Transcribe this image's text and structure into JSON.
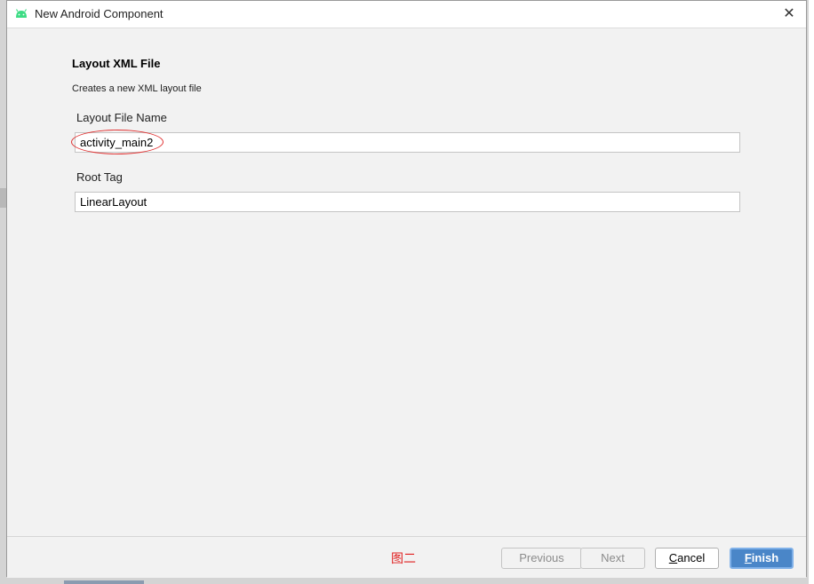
{
  "window": {
    "title": "New Android Component",
    "close_symbol": "✕",
    "icon": "android-icon"
  },
  "form": {
    "section_title": "Layout XML File",
    "section_description": "Creates a new XML layout file",
    "layout_file_name_label": "Layout File Name",
    "layout_file_name_value": "activity_main2",
    "root_tag_label": "Root Tag",
    "root_tag_value": "LinearLayout"
  },
  "annotation": {
    "figure_label": "图二",
    "highlight_color": "#e03030"
  },
  "footer": {
    "previous_label": "Previous",
    "next_label": "Next",
    "cancel_mnemonic": "C",
    "cancel_rest": "ancel",
    "finish_mnemonic": "F",
    "finish_rest": "inish"
  },
  "colors": {
    "accent": "#4a86c8",
    "android_green": "#3ddc84"
  }
}
